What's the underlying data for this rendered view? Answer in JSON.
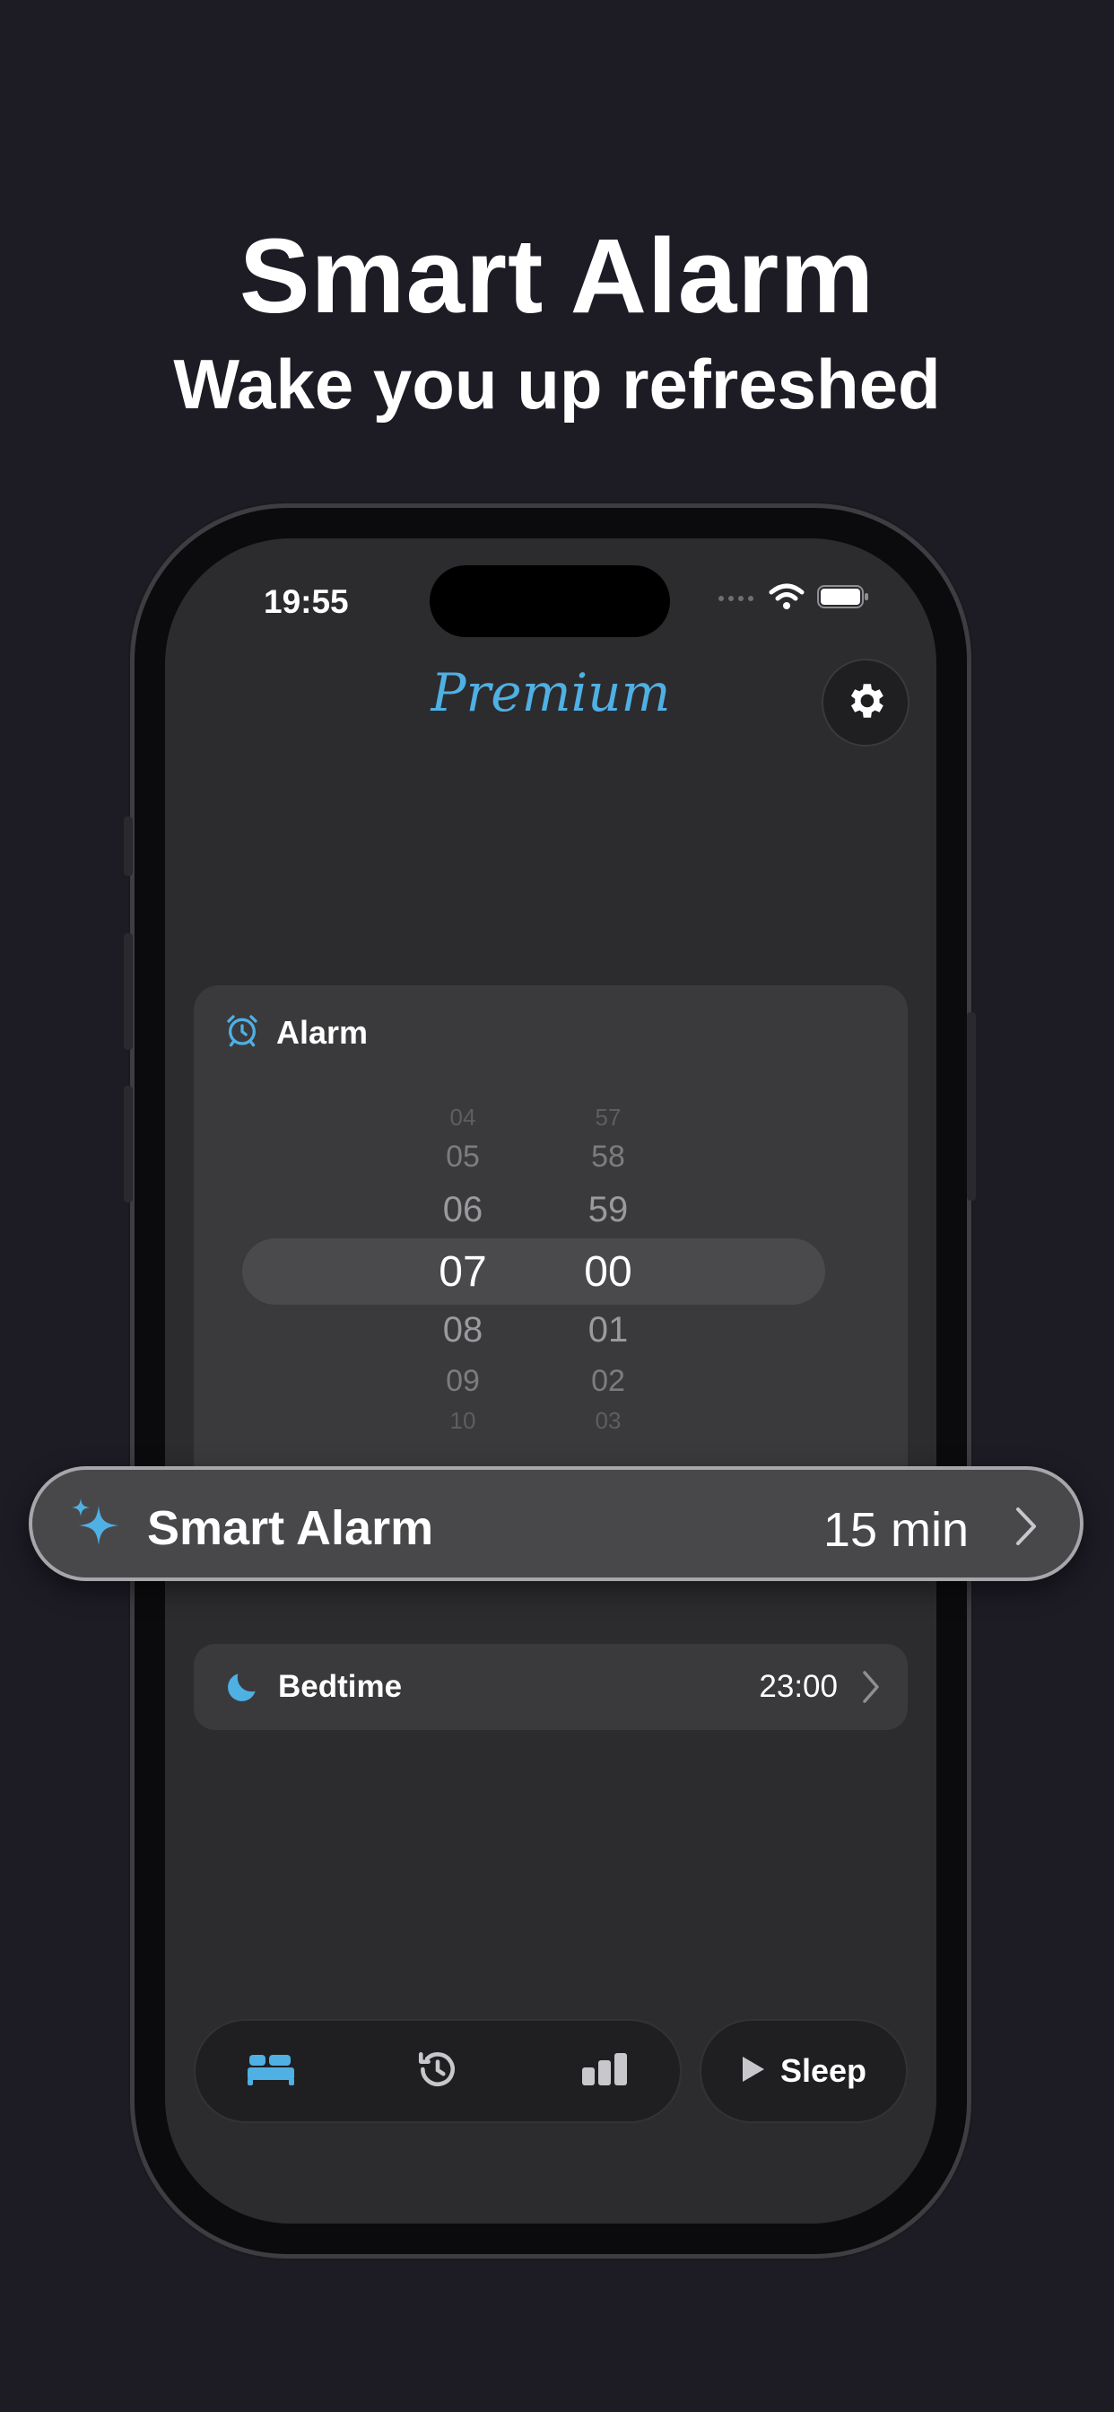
{
  "header": {
    "title": "Smart Alarm",
    "subtitle": "Wake you up refreshed"
  },
  "status_bar": {
    "time": "19:55"
  },
  "app": {
    "logo_text": "Premium"
  },
  "alarm": {
    "label": "Alarm",
    "hours": [
      "04",
      "05",
      "06",
      "07",
      "08",
      "09",
      "10"
    ],
    "minutes": [
      "57",
      "58",
      "59",
      "00",
      "01",
      "02",
      "03"
    ],
    "selected_hour": "07",
    "selected_minute": "00"
  },
  "smart_alarm": {
    "label": "Smart Alarm",
    "value": "15 min"
  },
  "bedtime": {
    "label": "Bedtime",
    "value": "23:00"
  },
  "tab_bar": {
    "items": [
      {
        "name": "bed-icon",
        "active": true
      },
      {
        "name": "history-icon",
        "active": false
      },
      {
        "name": "stats-icon",
        "active": false
      }
    ]
  },
  "sleep_button": {
    "label": "Sleep"
  },
  "colors": {
    "accent": "#4fb0e4",
    "background": "#1d1b24",
    "screen": "#2c2c2e",
    "card": "#3a3a3c"
  }
}
